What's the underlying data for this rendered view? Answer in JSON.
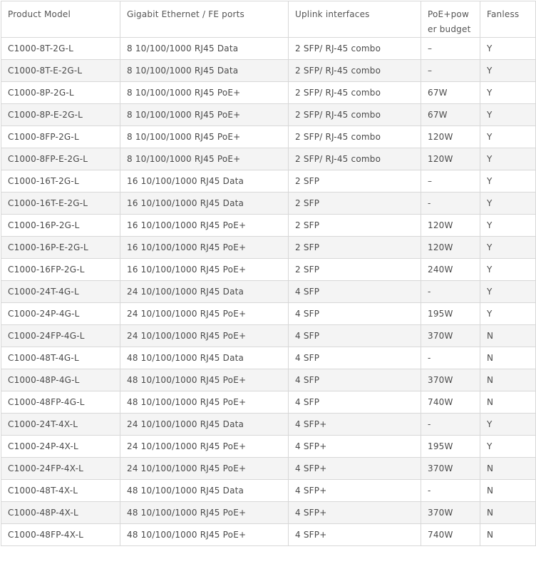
{
  "table": {
    "headers": [
      "Product Model",
      "Gigabit Ethernet / FE ports",
      "Uplink interfaces",
      "PoE+power budget",
      "Fanless"
    ],
    "rows": [
      [
        "C1000-8T-2G-L",
        "8 10/100/1000 RJ45 Data",
        "2 SFP/ RJ-45 combo",
        "–",
        "Y"
      ],
      [
        "C1000-8T-E-2G-L",
        "8 10/100/1000 RJ45 Data",
        "2 SFP/ RJ-45 combo",
        "–",
        "Y"
      ],
      [
        "C1000-8P-2G-L",
        "8 10/100/1000 RJ45 PoE+",
        "2 SFP/ RJ-45 combo",
        "67W",
        "Y"
      ],
      [
        "C1000-8P-E-2G-L",
        "8 10/100/1000 RJ45 PoE+",
        "2 SFP/ RJ-45 combo",
        "67W",
        "Y"
      ],
      [
        "C1000-8FP-2G-L",
        "8 10/100/1000 RJ45 PoE+",
        "2 SFP/ RJ-45 combo",
        "120W",
        "Y"
      ],
      [
        "C1000-8FP-E-2G-L",
        "8 10/100/1000 RJ45 PoE+",
        "2 SFP/ RJ-45 combo",
        "120W",
        "Y"
      ],
      [
        "C1000-16T-2G-L",
        "16 10/100/1000 RJ45 Data",
        "2 SFP",
        "–",
        "Y"
      ],
      [
        "C1000-16T-E-2G-L",
        "16 10/100/1000 RJ45 Data",
        "2 SFP",
        "-",
        "Y"
      ],
      [
        "C1000-16P-2G-L",
        "16 10/100/1000 RJ45 PoE+",
        "2 SFP",
        "120W",
        "Y"
      ],
      [
        "C1000-16P-E-2G-L",
        "16 10/100/1000 RJ45 PoE+",
        "2 SFP",
        "120W",
        "Y"
      ],
      [
        "C1000-16FP-2G-L",
        "16 10/100/1000 RJ45 PoE+",
        "2 SFP",
        "240W",
        "Y"
      ],
      [
        "C1000-24T-4G-L",
        "24 10/100/1000 RJ45 Data",
        "4 SFP",
        "-",
        "Y"
      ],
      [
        "C1000-24P-4G-L",
        "24 10/100/1000 RJ45 PoE+",
        "4 SFP",
        "195W",
        "Y"
      ],
      [
        "C1000-24FP-4G-L",
        "24 10/100/1000 RJ45 PoE+",
        "4 SFP",
        "370W",
        "N"
      ],
      [
        "C1000-48T-4G-L",
        "48 10/100/1000 RJ45 Data",
        "4 SFP",
        "-",
        "N"
      ],
      [
        "C1000-48P-4G-L",
        "48 10/100/1000 RJ45 PoE+",
        "4 SFP",
        "370W",
        "N"
      ],
      [
        "C1000-48FP-4G-L",
        "48 10/100/1000 RJ45 PoE+",
        "4 SFP",
        "740W",
        "N"
      ],
      [
        "C1000-24T-4X-L",
        "24 10/100/1000 RJ45 Data",
        "4 SFP+",
        "-",
        "Y"
      ],
      [
        "C1000-24P-4X-L",
        "24 10/100/1000 RJ45 PoE+",
        "4 SFP+",
        "195W",
        "Y"
      ],
      [
        "C1000-24FP-4X-L",
        "24 10/100/1000 RJ45 PoE+",
        "4 SFP+",
        "370W",
        "N"
      ],
      [
        "C1000-48T-4X-L",
        "48 10/100/1000 RJ45 Data",
        "4 SFP+",
        "-",
        "N"
      ],
      [
        "C1000-48P-4X-L",
        "48 10/100/1000 RJ45 PoE+",
        "4 SFP+",
        "370W",
        "N"
      ],
      [
        "C1000-48FP-4X-L",
        "48 10/100/1000 RJ45 PoE+",
        "4 SFP+",
        "740W",
        "N"
      ]
    ]
  }
}
